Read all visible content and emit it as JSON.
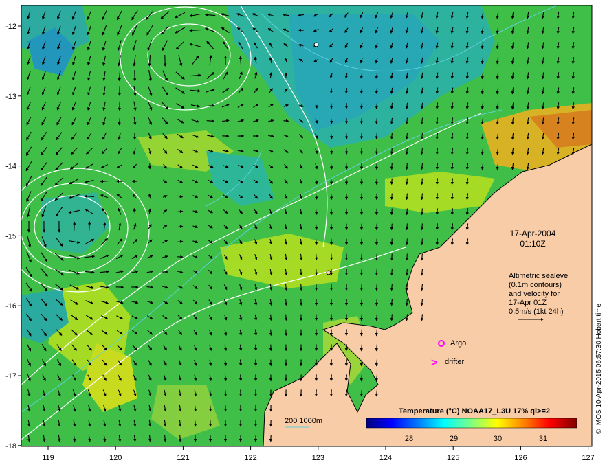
{
  "map": {
    "date_line1": "17-Apr-2004",
    "date_line2": "01:10Z",
    "info_lines": [
      "Altimetric sealevel",
      "(0.1m contours)",
      "and velocity for",
      "17-Apr 01Z",
      "0.5m/s (1kt 24h)"
    ],
    "credit": "© IMOS 10-Apr-2015 06:57:30 Hobart time",
    "markers": {
      "argo_label": "Argo",
      "drifter_label": "drifter",
      "drifter_symbol": ">"
    },
    "depth_legend": {
      "label": "200  1000m"
    },
    "colorbar": {
      "title": "Temperature (°C) NOAA17_L3U 17% ql>=2",
      "ticks": [
        "28",
        "29",
        "30",
        "31"
      ],
      "colors": [
        "#00007f",
        "#0000ff",
        "#0080ff",
        "#00ffff",
        "#80ff80",
        "#ffff00",
        "#ff8000",
        "#ff0000",
        "#800000"
      ]
    },
    "x_ticks": [
      "119",
      "120",
      "121",
      "122",
      "123",
      "124",
      "125",
      "126",
      "127"
    ],
    "y_ticks": [
      "-12",
      "-13",
      "-14",
      "-15",
      "-16",
      "-17",
      "-18"
    ],
    "colors": {
      "land": "#f9cca8",
      "ocean_main": "#3fbf48",
      "argo": "#ff00ff",
      "drifter": "#ff00ff",
      "contour": "#ffffff",
      "isobath": "#60d0d8"
    }
  }
}
